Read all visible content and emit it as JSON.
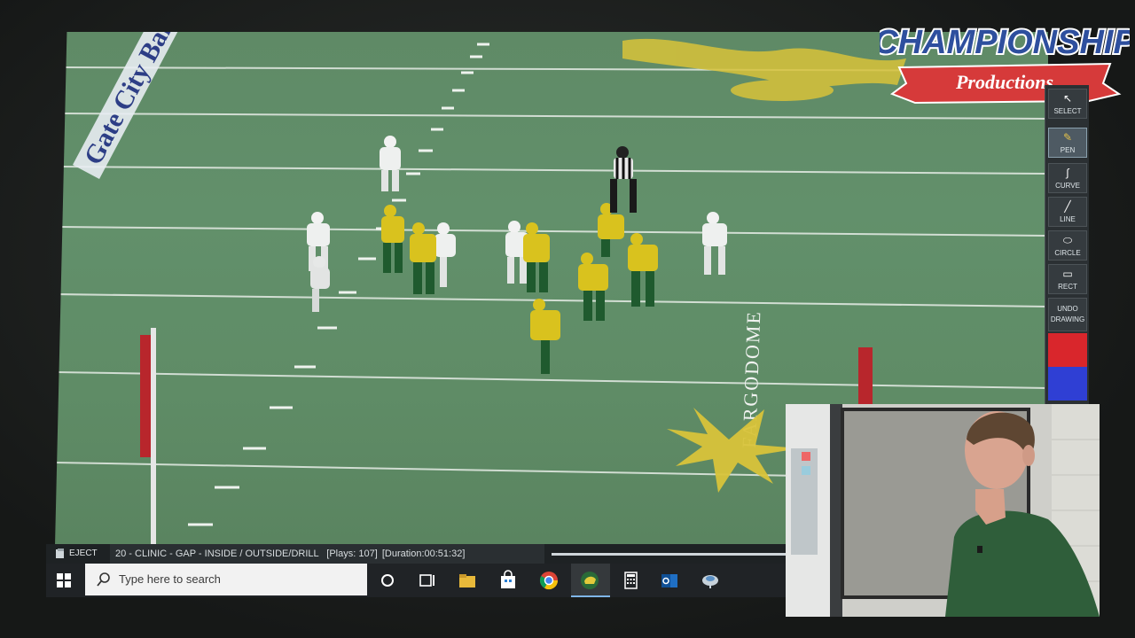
{
  "logo": {
    "line1": "CHAMPIONSHIP",
    "line2": "Productions",
    "colors": {
      "blue": "#2e4f9e",
      "red": "#d63a3a",
      "white": "#ffffff"
    }
  },
  "field": {
    "stadium_text": "FARGODOME",
    "end_zone_text": "Gate City Bank Field",
    "colors": {
      "turf": "#5f8c66",
      "home_jersey": "#d9c21e",
      "home_pants": "#1f5a2e",
      "away_jersey": "#eef0ef",
      "logo_yellow": "#d8c33a"
    }
  },
  "toolbar": {
    "items": [
      {
        "label": "SELECT",
        "icon": "cursor-icon"
      },
      {
        "label": "PEN",
        "icon": "pen-icon",
        "active": true
      },
      {
        "label": "CURVE",
        "icon": "curve-icon"
      },
      {
        "label": "LINE",
        "icon": "line-icon"
      },
      {
        "label": "CIRCLE",
        "icon": "circle-icon"
      },
      {
        "label": "RECT",
        "icon": "rect-icon"
      },
      {
        "label": "UNDO DRAWING",
        "icon": "undo-icon"
      }
    ],
    "swatches": [
      "#d9262c",
      "#2f3fd4"
    ]
  },
  "player": {
    "eject_label": "EJECT",
    "file_title": "20 - CLINIC - GAP - INSIDE / OUTSIDE/DRILL",
    "plays": "[Plays: 107]",
    "duration": "[Duration:00:51:32]",
    "progress": 0.97
  },
  "taskbar": {
    "search_placeholder": "Type here to search",
    "icons": [
      "cortana-icon",
      "task-view-icon",
      "file-explorer-icon",
      "store-icon",
      "chrome-icon",
      "bison-app-icon",
      "calculator-icon",
      "outlook-icon",
      "network-icon"
    ]
  }
}
